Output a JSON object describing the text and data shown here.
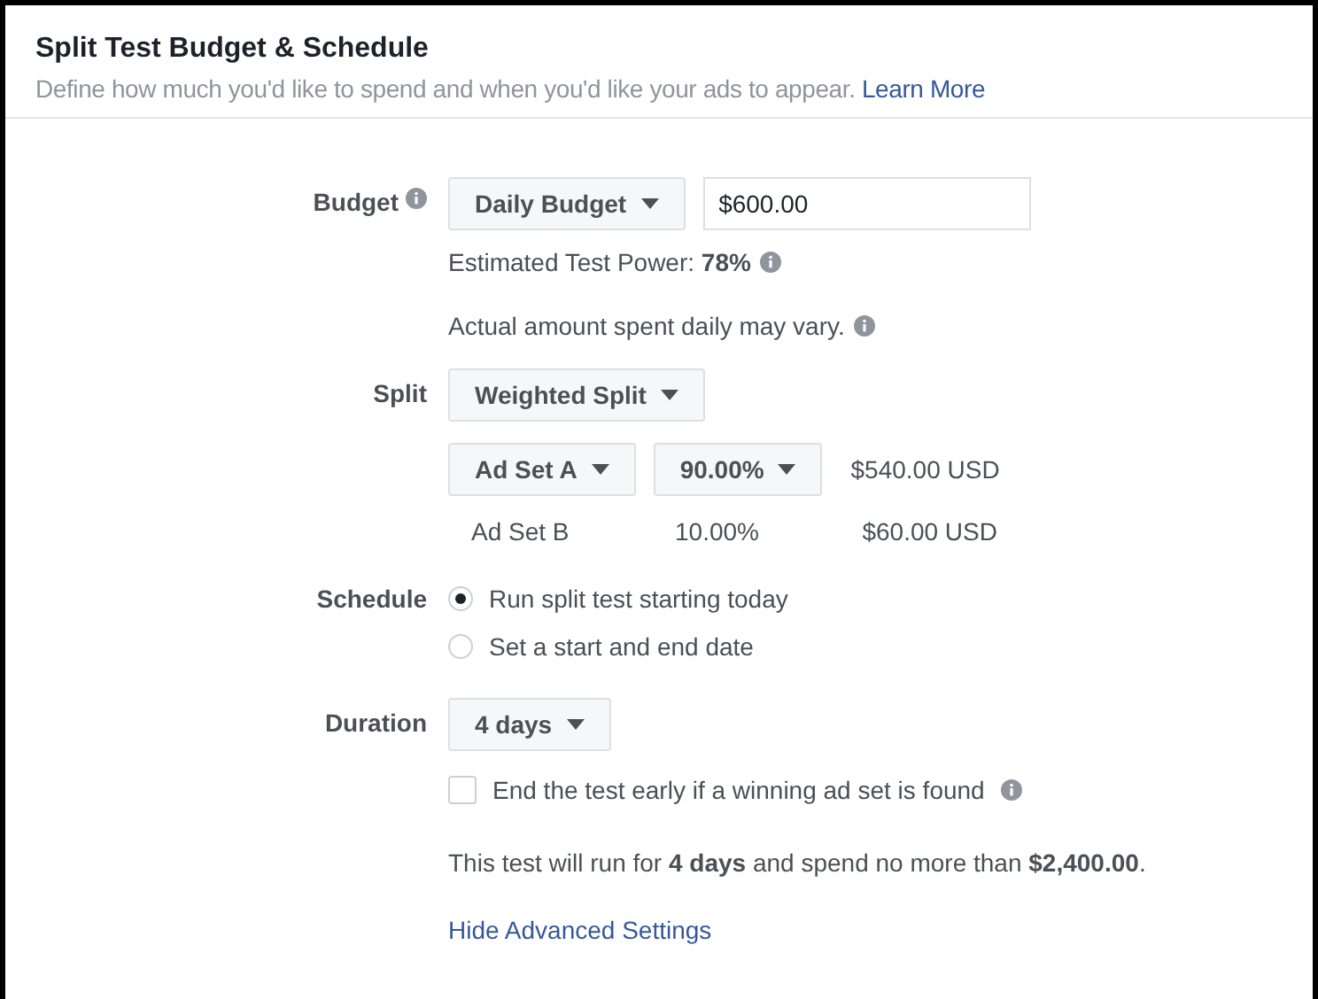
{
  "header": {
    "title": "Split Test Budget & Schedule",
    "description": "Define how much you'd like to spend and when you'd like your ads to appear.",
    "learn_more": "Learn More"
  },
  "budget": {
    "label": "Budget",
    "type_dropdown": "Daily Budget",
    "amount": "$600.00",
    "power": "Estimated Test Power: **78%**",
    "note": "Actual amount spent daily may vary."
  },
  "split": {
    "label": "Split",
    "dropdown": "Weighted Split",
    "rows": [
      {
        "ad_set": "Ad Set A",
        "percent": "90.00%",
        "amount": "$540.00 USD",
        "editable": true
      },
      {
        "ad_set": "Ad Set B",
        "percent": "10.00%",
        "amount": "$60.00 USD",
        "editable": false
      }
    ]
  },
  "schedule": {
    "label": "Schedule",
    "options": [
      {
        "label": "Run split test starting today",
        "selected": true
      },
      {
        "label": "Set a start and end date",
        "selected": false
      }
    ]
  },
  "duration": {
    "label": "Duration",
    "dropdown": "4 days",
    "end_early": {
      "label": "End the test early if a winning ad set is found",
      "checked": false
    },
    "summary": "This test will run for **4 days** and spend no more than **$2,400.00**."
  },
  "advanced_link": "Hide Advanced Settings"
}
